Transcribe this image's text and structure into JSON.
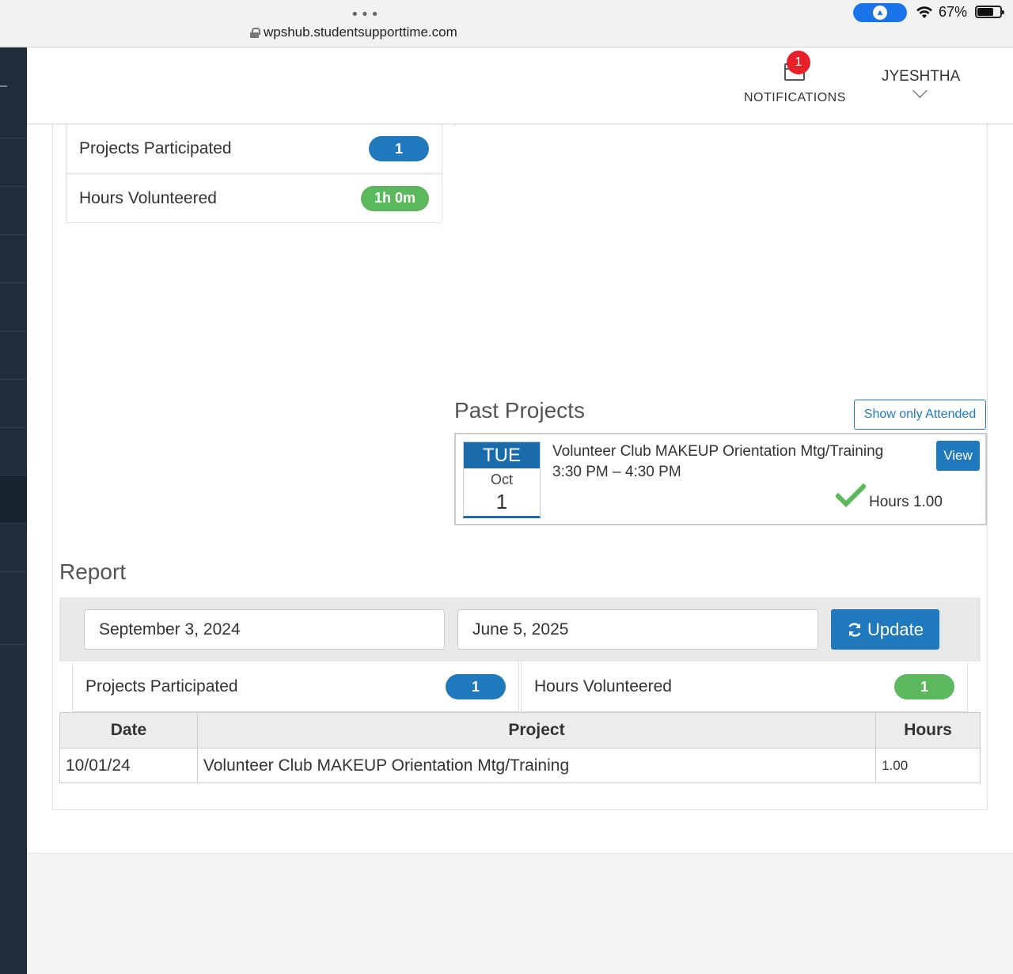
{
  "browser": {
    "url": "wpshub.studentsupporttime.com",
    "dots": "•••",
    "battery": "67%"
  },
  "header": {
    "notifications_label": "NOTIFICATIONS",
    "notifications_count": "1",
    "user_name": "JYESHTHA"
  },
  "stats": {
    "projects_label": "Projects Participated",
    "projects_value": "1",
    "hours_label": "Hours Volunteered",
    "hours_value": "1h 0m"
  },
  "past_projects": {
    "title": "Past Projects",
    "filter_button": "Show only Attended",
    "items": [
      {
        "dow": "TUE",
        "month": "Oct",
        "day": "1",
        "name": "Volunteer Club MAKEUP Orientation Mtg/Training",
        "time": "3:30 PM – 4:30 PM",
        "view_label": "View",
        "hours": "Hours 1.00",
        "attended": true
      }
    ]
  },
  "report": {
    "title": "Report",
    "start_date": "September 3, 2024",
    "end_date": "June 5, 2025",
    "update_label": "Update",
    "projects_label": "Projects Participated",
    "projects_value": "1",
    "hours_label": "Hours Volunteered",
    "hours_value": "1",
    "table": {
      "headers": [
        "Date",
        "Project",
        "Hours"
      ],
      "rows": [
        [
          "10/01/24",
          "Volunteer Club MAKEUP Orientation Mtg/Training",
          "1.00"
        ]
      ]
    }
  },
  "colors": {
    "primary": "#2079bd",
    "success": "#5cb85c",
    "danger": "#e8202a",
    "sidebar": "#1f2d3a"
  }
}
